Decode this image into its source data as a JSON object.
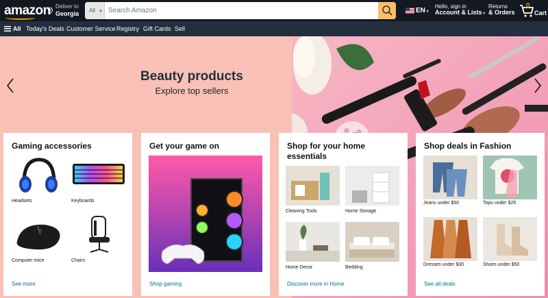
{
  "header": {
    "logo": "amazon",
    "deliver_to": "Deliver to",
    "location": "Georgia",
    "search_category": "All",
    "search_placeholder": "Search Amazon",
    "language": "EN",
    "account_greeting": "Hello, sign in",
    "account_label": "Account & Lists",
    "returns": "Returns",
    "orders": "& Orders",
    "cart_count": "0",
    "cart_label": "Cart"
  },
  "nav": {
    "all": "All",
    "items": [
      "Today's Deals",
      "Customer Service",
      "Registry",
      "Gift Cards",
      "Sell"
    ]
  },
  "hero": {
    "title": "Beauty products",
    "subtitle": "Explore top sellers"
  },
  "cards": [
    {
      "title": "Gaming accessories",
      "items": [
        "Headsets",
        "Keyboards",
        "Computer mice",
        "Chairs"
      ],
      "link": "See more"
    },
    {
      "title": "Get your game on",
      "link": "Shop gaming"
    },
    {
      "title": "Shop for your home essentials",
      "items": [
        "Cleaning Tools",
        "Home Storage",
        "Home Decor",
        "Bedding"
      ],
      "link": "Discover more in Home"
    },
    {
      "title": "Shop deals in Fashion",
      "items": [
        "Jeans under $50",
        "Tops under $25",
        "Dresses under $30",
        "Shoes under $50"
      ],
      "link": "See all deals"
    }
  ],
  "colors": {
    "header_bg": "#131921",
    "nav_bg": "#232f3e",
    "search_button": "#febd69",
    "accent": "#ff9900",
    "link": "#007185"
  },
  "icons": [
    "location-pin-icon",
    "search-icon",
    "us-flag-icon",
    "cart-icon",
    "hamburger-icon",
    "chevron-left-icon",
    "chevron-right-icon"
  ]
}
